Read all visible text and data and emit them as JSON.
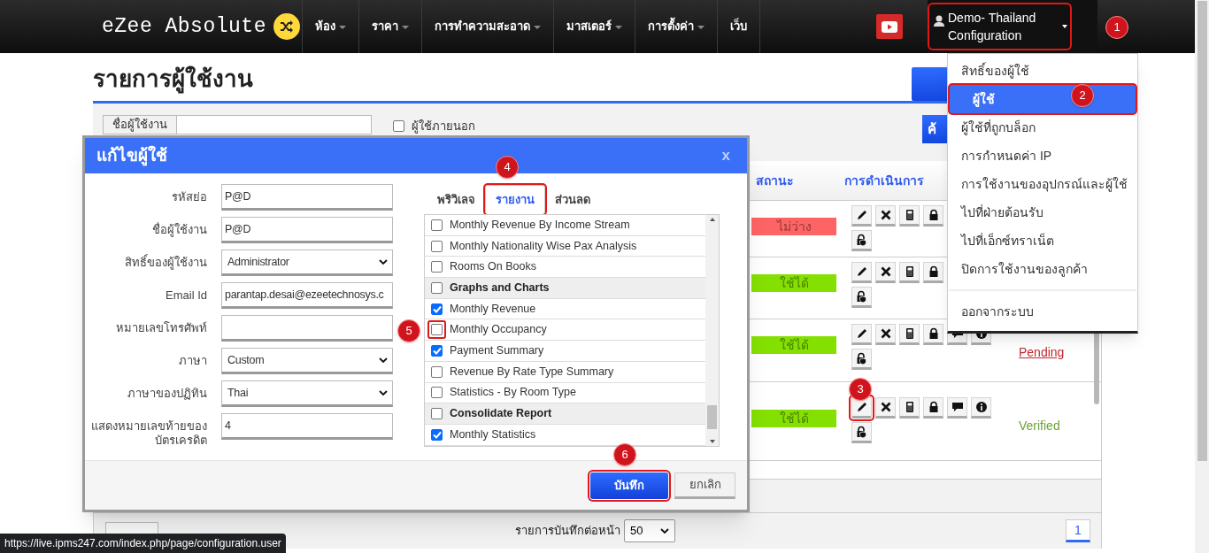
{
  "nav": {
    "logo": "eZee Absolute",
    "menu": [
      {
        "label": "ห้อง",
        "dropdown": true
      },
      {
        "label": "ราคา",
        "dropdown": true
      },
      {
        "label": "การทำความสะอาด",
        "dropdown": true
      },
      {
        "label": "มาสเตอร์",
        "dropdown": true
      },
      {
        "label": "การตั้งค่า",
        "dropdown": true
      },
      {
        "label": "เว็บ",
        "dropdown": false
      }
    ],
    "user": {
      "name_lines": [
        "Demo- Thailand",
        "Configuration"
      ],
      "highlighted": true
    }
  },
  "user_menu": {
    "sections": [
      {
        "items": [
          {
            "label": "สิทธิ์ของผู้ใช้",
            "selected": false,
            "highlighted": false
          },
          {
            "label": "ผู้ใช้",
            "selected": true,
            "highlighted": true
          },
          {
            "label": "ผู้ใช้ที่ถูกบล็อก",
            "selected": false,
            "highlighted": false
          },
          {
            "label": "การกำหนดค่า IP",
            "selected": false,
            "highlighted": false
          },
          {
            "label": "การใช้งานของอุปกรณ์และผู้ใช้",
            "selected": false,
            "highlighted": false
          },
          {
            "label": "ไปที่ฝ่ายต้อนรับ",
            "selected": false,
            "highlighted": false
          },
          {
            "label": "ไปที่เอ็กซ์ทราเน็ต",
            "selected": false,
            "highlighted": false
          },
          {
            "label": "ปิดการใช้งานของลูกค้า",
            "selected": false,
            "highlighted": false
          }
        ]
      },
      {
        "items": [
          {
            "label": "ออกจากระบบ",
            "selected": false,
            "highlighted": false
          }
        ]
      }
    ]
  },
  "page": {
    "title": "รายการผู้ใช้งาน",
    "filter_label": "ชื่อผู้ใช้งาน",
    "external_user": {
      "label": "ผู้ใช้ภายนอก",
      "checked": false
    },
    "search_button": "ค้",
    "columns": [
      "สถานะ",
      "การดำเนินการ"
    ],
    "rows": [
      {
        "status": "ไม่ว่าง",
        "color": "#ff6464",
        "actions": [
          {
            "kind": "edit",
            "highlighted": false
          },
          {
            "kind": "delete",
            "highlighted": false
          },
          {
            "kind": "device",
            "highlighted": false
          },
          {
            "kind": "lock",
            "highlighted": false
          },
          {
            "kind": "unlock",
            "highlighted": false
          }
        ]
      },
      {
        "status": "ใช้ได้",
        "color": "#84e000",
        "actions": [
          {
            "kind": "edit",
            "highlighted": false
          },
          {
            "kind": "delete",
            "highlighted": false
          },
          {
            "kind": "device",
            "highlighted": false
          },
          {
            "kind": "lock",
            "highlighted": false
          },
          {
            "kind": "unlock",
            "highlighted": false
          }
        ]
      },
      {
        "status": "ใช้ได้",
        "color": "#84e000",
        "actions": [
          {
            "kind": "edit",
            "highlighted": false
          },
          {
            "kind": "delete",
            "highlighted": false
          },
          {
            "kind": "device",
            "highlighted": false
          },
          {
            "kind": "lock",
            "highlighted": false
          },
          {
            "kind": "message",
            "highlighted": false
          },
          {
            "kind": "info",
            "highlighted": false
          },
          {
            "kind": "unlock",
            "highlighted": false
          }
        ],
        "verification": {
          "text": "Pending",
          "kind": "pending"
        }
      },
      {
        "status": "ใช้ได้",
        "color": "#84e000",
        "actions": [
          {
            "kind": "edit",
            "highlighted": true
          },
          {
            "kind": "delete",
            "highlighted": false
          },
          {
            "kind": "device",
            "highlighted": false
          },
          {
            "kind": "lock",
            "highlighted": false
          },
          {
            "kind": "message",
            "highlighted": false
          },
          {
            "kind": "info",
            "highlighted": false
          },
          {
            "kind": "unlock",
            "highlighted": false
          }
        ],
        "verification": {
          "text": "Verified",
          "kind": "verified"
        }
      }
    ],
    "pagination": {
      "per_page_label": "รายการบันทึกต่อหน้า",
      "per_page": "50",
      "pages": [
        {
          "label": "1",
          "selected": true
        }
      ]
    }
  },
  "modal": {
    "title": "แก้ไขผู้ใช้",
    "close": "x",
    "fields": [
      {
        "label": "รหัสย่อ",
        "kind": "text",
        "value": "P@D"
      },
      {
        "label": "ชื่อผู้ใช้งาน",
        "kind": "text",
        "value": "P@D"
      },
      {
        "label": "สิทธิ์ของผู้ใช้งาน",
        "kind": "select",
        "value": "Administrator"
      },
      {
        "label": "Email Id",
        "kind": "text",
        "value": "parantap.desai@ezeetechnosys.c"
      },
      {
        "label": "หมายเลขโทรศัพท์",
        "kind": "text"
      },
      {
        "label": "ภาษา",
        "kind": "select",
        "value": "Custom"
      },
      {
        "label": "ภาษาของปฏิทิน",
        "kind": "select",
        "value": "Thai"
      },
      {
        "label": "แสดงหมายเลขท้ายของบัตรเครดิต",
        "kind": "text",
        "value": "4"
      }
    ],
    "tabs": [
      {
        "label": "พริวิเลจ",
        "selected": false,
        "highlighted": false
      },
      {
        "label": "รายงาน",
        "selected": true,
        "highlighted": true
      },
      {
        "label": "ส่วนลด",
        "selected": false,
        "highlighted": false
      }
    ],
    "reports": [
      {
        "label": "Monthly Revenue By Income Stream",
        "kind": "item",
        "checked": false,
        "highlighted": false
      },
      {
        "label": "Monthly Nationality Wise Pax Analysis",
        "kind": "item",
        "checked": false,
        "highlighted": false
      },
      {
        "label": "Rooms On Books",
        "kind": "item",
        "checked": false,
        "highlighted": false
      },
      {
        "label": "Graphs and Charts",
        "kind": "group",
        "checked": false,
        "highlighted": false
      },
      {
        "label": "Monthly Revenue",
        "kind": "item",
        "checked": true,
        "highlighted": false
      },
      {
        "label": "Monthly Occupancy",
        "kind": "item",
        "checked": false,
        "highlighted": true
      },
      {
        "label": "Payment Summary",
        "kind": "item",
        "checked": true,
        "highlighted": false
      },
      {
        "label": "Revenue By Rate Type Summary",
        "kind": "item",
        "checked": false,
        "highlighted": false
      },
      {
        "label": "Statistics - By Room Type",
        "kind": "item",
        "checked": false,
        "highlighted": false
      },
      {
        "label": "Consolidate Report",
        "kind": "group",
        "checked": false,
        "highlighted": false
      },
      {
        "label": "Monthly Statistics",
        "kind": "item",
        "checked": true,
        "highlighted": false
      }
    ],
    "buttons": [
      {
        "label": "บันทึก",
        "kind": "primary",
        "highlighted": true
      },
      {
        "label": "ยกเลิก",
        "kind": "secondary",
        "highlighted": false
      }
    ]
  },
  "callouts": [
    "1",
    "2",
    "3",
    "4",
    "5",
    "6"
  ],
  "status_url": "https://live.ipms247.com/index.php/page/configuration.user"
}
